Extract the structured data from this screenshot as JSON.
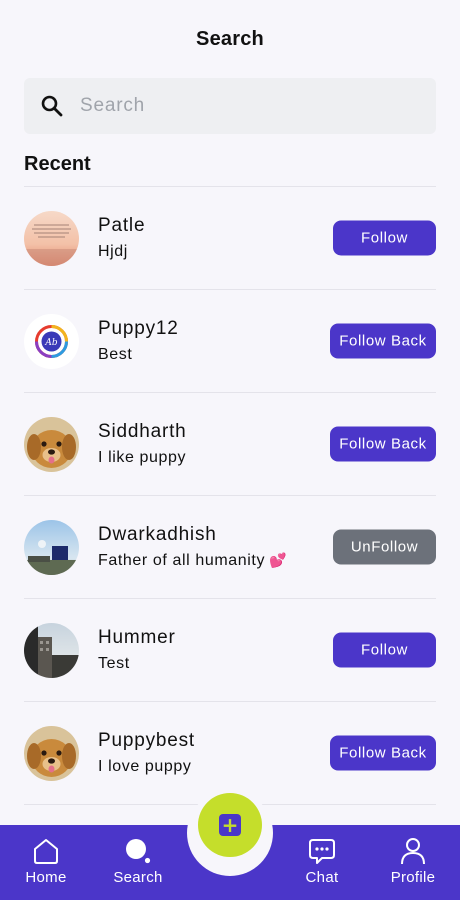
{
  "header": {
    "title": "Search"
  },
  "search": {
    "placeholder": "Search",
    "value": ""
  },
  "section": {
    "title": "Recent"
  },
  "users": [
    {
      "name": "Patle",
      "bio": "Hjdj",
      "button": "Follow",
      "state": "follow",
      "avatar": "quote-image"
    },
    {
      "name": "Puppy12",
      "bio": "Best",
      "button": "Follow Back",
      "state": "followback",
      "avatar": "logo-image"
    },
    {
      "name": "Siddharth",
      "bio": "I like puppy",
      "button": "Follow Back",
      "state": "followback",
      "avatar": "puppy-photo"
    },
    {
      "name": "Dwarkadhish",
      "bio": "Father of all humanity",
      "bio_emoji": "💕",
      "button": "UnFollow",
      "state": "unfollow",
      "avatar": "sky-photo"
    },
    {
      "name": "Hummer",
      "bio": "Test",
      "button": "Follow",
      "state": "follow",
      "avatar": "building-photo"
    },
    {
      "name": "Puppybest",
      "bio": "I love puppy",
      "button": "Follow Back",
      "state": "followback",
      "avatar": "puppy-photo"
    }
  ],
  "nav": {
    "home": "Home",
    "search": "Search",
    "chat": "Chat",
    "profile": "Profile",
    "fab_icon": "plus-icon"
  },
  "colors": {
    "accent": "#4b36c9",
    "fab": "#c5de2b",
    "unfollow": "#6c717a",
    "background": "#f7f6fb"
  }
}
